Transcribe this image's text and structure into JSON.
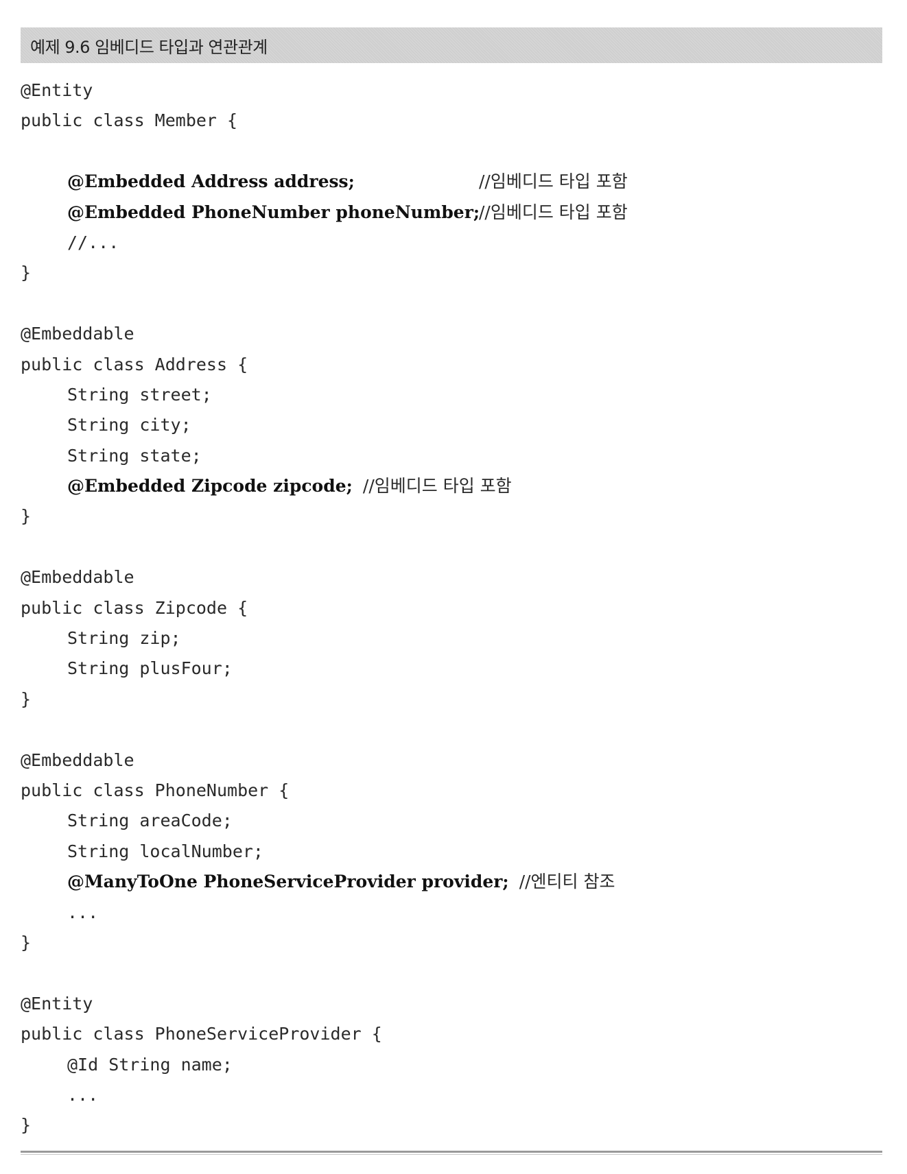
{
  "caption": "예제 9.6 임베디드 타입과 연관관계",
  "code": {
    "member": {
      "annotation": "@Entity",
      "decl": "public class Member {",
      "field1": "@Embedded Address address;",
      "field1_comment": "//임베디드 타입 포함",
      "field2": "@Embedded PhoneNumber phoneNumber;",
      "field2_comment": "//임베디드 타입 포함",
      "ellipsis": "//...",
      "close": "}"
    },
    "address": {
      "annotation": "@Embeddable",
      "decl": "public class Address {",
      "f1": "String street;",
      "f2": "String city;",
      "f3": "String state;",
      "f4": "@Embedded Zipcode zipcode;",
      "f4_comment": "//임베디드 타입 포함",
      "close": "}"
    },
    "zipcode": {
      "annotation": "@Embeddable",
      "decl": "public class Zipcode {",
      "f1": "String zip;",
      "f2": "String plusFour;",
      "close": "}"
    },
    "phone": {
      "annotation": "@Embeddable",
      "decl": "public class PhoneNumber {",
      "f1": "String areaCode;",
      "f2": "String localNumber;",
      "f3": "@ManyToOne PhoneServiceProvider provider;",
      "f3_comment": "//엔티티 참조",
      "ellipsis": "...",
      "close": "}"
    },
    "provider": {
      "annotation": "@Entity",
      "decl": "public class PhoneServiceProvider {",
      "f1": "@Id String name;",
      "ellipsis": "...",
      "close": "}"
    }
  }
}
